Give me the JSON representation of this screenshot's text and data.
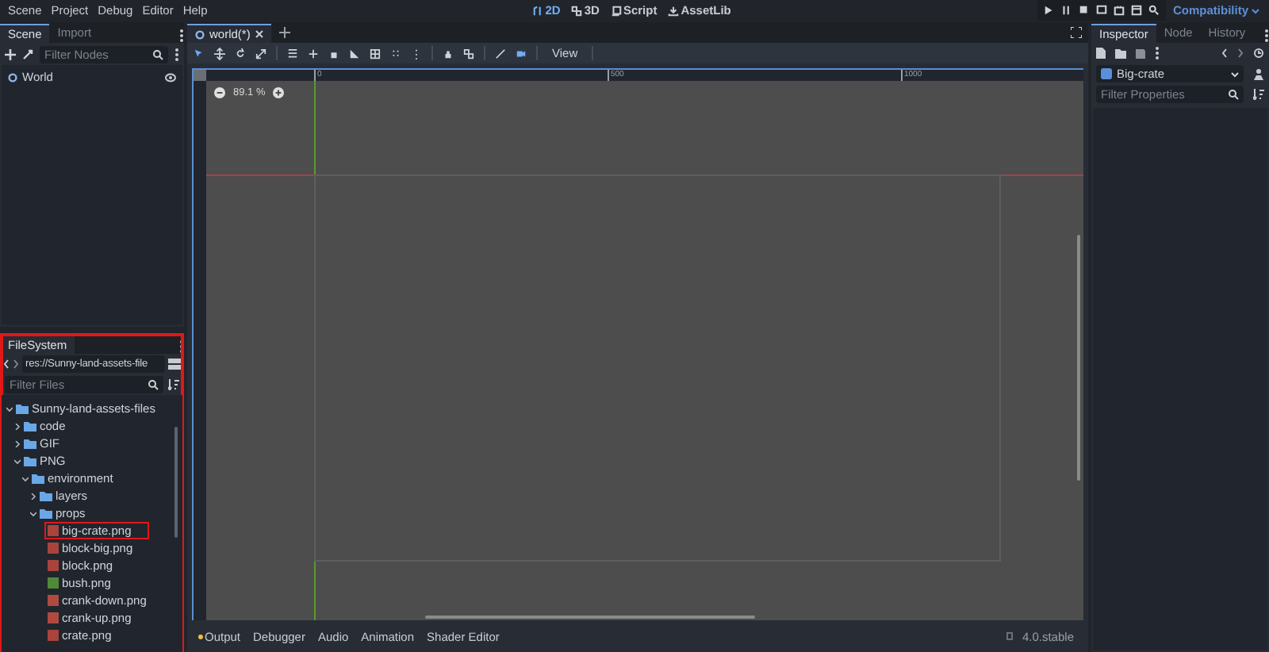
{
  "menu_bar": {
    "menus": [
      "Scene",
      "Project",
      "Debug",
      "Editor",
      "Help"
    ],
    "workspaces": [
      {
        "label": "2D",
        "selected": true
      },
      {
        "label": "3D",
        "selected": false
      },
      {
        "label": "Script",
        "selected": false
      },
      {
        "label": "AssetLib",
        "selected": false
      }
    ],
    "renderer": "Compatibility"
  },
  "scene_dock": {
    "tabs": [
      {
        "label": "Scene",
        "selected": true
      },
      {
        "label": "Import",
        "selected": false
      }
    ],
    "filter": {
      "placeholder": "Filter Nodes"
    },
    "nodes": [
      {
        "name": "World",
        "visible": true
      }
    ]
  },
  "filesystem_dock": {
    "highlighted": true,
    "tabs": [
      {
        "label": "FileSystem",
        "selected": true
      }
    ],
    "path": "res://Sunny-land-assets-file",
    "filter": {
      "placeholder": "Filter Files"
    },
    "tree": [
      {
        "label": "Sunny-land-assets-files",
        "kind": "folder",
        "expanded": true,
        "children": [
          {
            "label": "code",
            "kind": "folder",
            "expanded": false
          },
          {
            "label": "GIF",
            "kind": "folder",
            "expanded": false
          },
          {
            "label": "PNG",
            "kind": "folder",
            "expanded": true,
            "children": [
              {
                "label": "environment",
                "kind": "folder",
                "expanded": true,
                "children": [
                  {
                    "label": "layers",
                    "kind": "folder",
                    "expanded": false
                  },
                  {
                    "label": "props",
                    "kind": "folder",
                    "expanded": true,
                    "children": [
                      {
                        "label": "big-crate.png",
                        "kind": "file",
                        "color": "#a8443c",
                        "highlighted": true
                      },
                      {
                        "label": "block-big.png",
                        "kind": "file",
                        "color": "#a8443c",
                        "highlighted": false
                      },
                      {
                        "label": "block.png",
                        "kind": "file",
                        "color": "#a8443c",
                        "highlighted": false
                      },
                      {
                        "label": "bush.png",
                        "kind": "file",
                        "color": "#4f8a3a",
                        "highlighted": false
                      },
                      {
                        "label": "crank-down.png",
                        "kind": "file",
                        "color": "#b04a40",
                        "highlighted": false
                      },
                      {
                        "label": "crank-up.png",
                        "kind": "file",
                        "color": "#b04a40",
                        "highlighted": false
                      },
                      {
                        "label": "crate.png",
                        "kind": "file",
                        "color": "#a8443c",
                        "highlighted": false
                      }
                    ]
                  }
                ]
              }
            ]
          }
        ]
      }
    ]
  },
  "editor": {
    "tabs": [
      {
        "label": "world(*)",
        "selected": true
      }
    ],
    "view_menu": "View",
    "zoom": "89.1 %",
    "ruler_marks": [
      "0",
      "500",
      "1000"
    ]
  },
  "bottom_panel": {
    "tabs": [
      {
        "label": "Output",
        "alert": true
      },
      {
        "label": "Debugger",
        "alert": false
      },
      {
        "label": "Audio",
        "alert": false
      },
      {
        "label": "Animation",
        "alert": false
      },
      {
        "label": "Shader Editor",
        "alert": false
      }
    ],
    "version": "4.0.stable"
  },
  "inspector": {
    "tabs": [
      {
        "label": "Inspector",
        "selected": true
      },
      {
        "label": "Node",
        "selected": false
      },
      {
        "label": "History",
        "selected": false
      }
    ],
    "object": "Big-crate",
    "filter": {
      "placeholder": "Filter Properties"
    }
  }
}
